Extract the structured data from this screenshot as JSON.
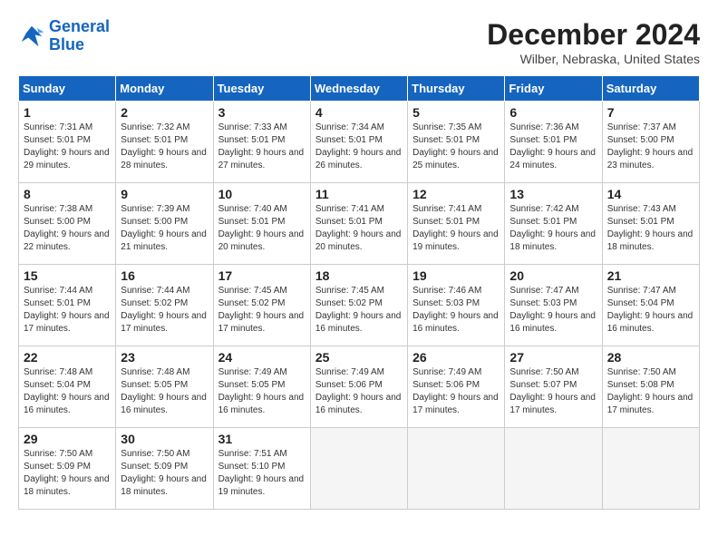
{
  "logo": {
    "line1": "General",
    "line2": "Blue"
  },
  "title": "December 2024",
  "location": "Wilber, Nebraska, United States",
  "days_of_week": [
    "Sunday",
    "Monday",
    "Tuesday",
    "Wednesday",
    "Thursday",
    "Friday",
    "Saturday"
  ],
  "weeks": [
    [
      {
        "day": 1,
        "sunrise": "7:31 AM",
        "sunset": "5:01 PM",
        "daylight": "9 hours and 29 minutes."
      },
      {
        "day": 2,
        "sunrise": "7:32 AM",
        "sunset": "5:01 PM",
        "daylight": "9 hours and 28 minutes."
      },
      {
        "day": 3,
        "sunrise": "7:33 AM",
        "sunset": "5:01 PM",
        "daylight": "9 hours and 27 minutes."
      },
      {
        "day": 4,
        "sunrise": "7:34 AM",
        "sunset": "5:01 PM",
        "daylight": "9 hours and 26 minutes."
      },
      {
        "day": 5,
        "sunrise": "7:35 AM",
        "sunset": "5:01 PM",
        "daylight": "9 hours and 25 minutes."
      },
      {
        "day": 6,
        "sunrise": "7:36 AM",
        "sunset": "5:01 PM",
        "daylight": "9 hours and 24 minutes."
      },
      {
        "day": 7,
        "sunrise": "7:37 AM",
        "sunset": "5:00 PM",
        "daylight": "9 hours and 23 minutes."
      }
    ],
    [
      {
        "day": 8,
        "sunrise": "7:38 AM",
        "sunset": "5:00 PM",
        "daylight": "9 hours and 22 minutes."
      },
      {
        "day": 9,
        "sunrise": "7:39 AM",
        "sunset": "5:00 PM",
        "daylight": "9 hours and 21 minutes."
      },
      {
        "day": 10,
        "sunrise": "7:40 AM",
        "sunset": "5:01 PM",
        "daylight": "9 hours and 20 minutes."
      },
      {
        "day": 11,
        "sunrise": "7:41 AM",
        "sunset": "5:01 PM",
        "daylight": "9 hours and 20 minutes."
      },
      {
        "day": 12,
        "sunrise": "7:41 AM",
        "sunset": "5:01 PM",
        "daylight": "9 hours and 19 minutes."
      },
      {
        "day": 13,
        "sunrise": "7:42 AM",
        "sunset": "5:01 PM",
        "daylight": "9 hours and 18 minutes."
      },
      {
        "day": 14,
        "sunrise": "7:43 AM",
        "sunset": "5:01 PM",
        "daylight": "9 hours and 18 minutes."
      }
    ],
    [
      {
        "day": 15,
        "sunrise": "7:44 AM",
        "sunset": "5:01 PM",
        "daylight": "9 hours and 17 minutes."
      },
      {
        "day": 16,
        "sunrise": "7:44 AM",
        "sunset": "5:02 PM",
        "daylight": "9 hours and 17 minutes."
      },
      {
        "day": 17,
        "sunrise": "7:45 AM",
        "sunset": "5:02 PM",
        "daylight": "9 hours and 17 minutes."
      },
      {
        "day": 18,
        "sunrise": "7:45 AM",
        "sunset": "5:02 PM",
        "daylight": "9 hours and 16 minutes."
      },
      {
        "day": 19,
        "sunrise": "7:46 AM",
        "sunset": "5:03 PM",
        "daylight": "9 hours and 16 minutes."
      },
      {
        "day": 20,
        "sunrise": "7:47 AM",
        "sunset": "5:03 PM",
        "daylight": "9 hours and 16 minutes."
      },
      {
        "day": 21,
        "sunrise": "7:47 AM",
        "sunset": "5:04 PM",
        "daylight": "9 hours and 16 minutes."
      }
    ],
    [
      {
        "day": 22,
        "sunrise": "7:48 AM",
        "sunset": "5:04 PM",
        "daylight": "9 hours and 16 minutes."
      },
      {
        "day": 23,
        "sunrise": "7:48 AM",
        "sunset": "5:05 PM",
        "daylight": "9 hours and 16 minutes."
      },
      {
        "day": 24,
        "sunrise": "7:49 AM",
        "sunset": "5:05 PM",
        "daylight": "9 hours and 16 minutes."
      },
      {
        "day": 25,
        "sunrise": "7:49 AM",
        "sunset": "5:06 PM",
        "daylight": "9 hours and 16 minutes."
      },
      {
        "day": 26,
        "sunrise": "7:49 AM",
        "sunset": "5:06 PM",
        "daylight": "9 hours and 17 minutes."
      },
      {
        "day": 27,
        "sunrise": "7:50 AM",
        "sunset": "5:07 PM",
        "daylight": "9 hours and 17 minutes."
      },
      {
        "day": 28,
        "sunrise": "7:50 AM",
        "sunset": "5:08 PM",
        "daylight": "9 hours and 17 minutes."
      }
    ],
    [
      {
        "day": 29,
        "sunrise": "7:50 AM",
        "sunset": "5:09 PM",
        "daylight": "9 hours and 18 minutes."
      },
      {
        "day": 30,
        "sunrise": "7:50 AM",
        "sunset": "5:09 PM",
        "daylight": "9 hours and 18 minutes."
      },
      {
        "day": 31,
        "sunrise": "7:51 AM",
        "sunset": "5:10 PM",
        "daylight": "9 hours and 19 minutes."
      },
      null,
      null,
      null,
      null
    ]
  ]
}
